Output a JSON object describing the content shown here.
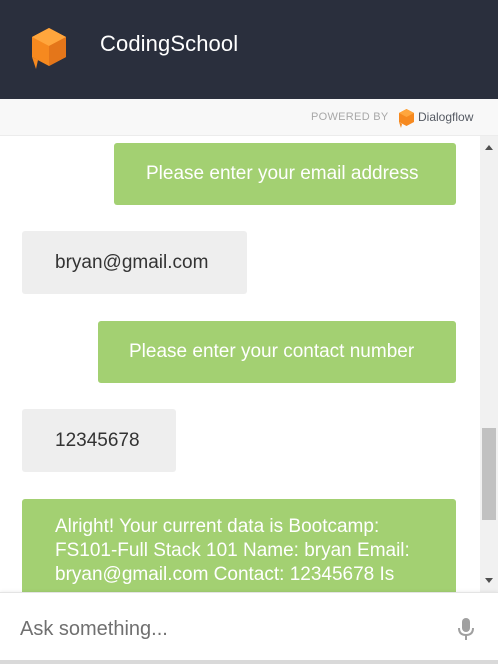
{
  "header": {
    "title": "CodingSchool",
    "logo_icon": "orange-cube-logo-icon"
  },
  "powered": {
    "label": "POWERED BY",
    "brand": "Dialogflow"
  },
  "messages": [
    {
      "role": "bot",
      "text": "Please enter your email address"
    },
    {
      "role": "user",
      "text": "bryan@gmail.com"
    },
    {
      "role": "bot",
      "text": "Please enter your contact number"
    },
    {
      "role": "user",
      "text": "12345678"
    },
    {
      "role": "bot",
      "text": "Alright! Your current data is Bootcamp: FS101-Full Stack 101 Name: bryan Email: bryan@gmail.com Contact: 12345678 Is"
    }
  ],
  "input": {
    "placeholder": "Ask something...",
    "mic_icon": "microphone-icon"
  },
  "colors": {
    "header_bg": "#2a2f3d",
    "bot_bubble": "#a3d072",
    "user_bubble": "#eeeeee",
    "logo_orange": "#f6891f"
  }
}
